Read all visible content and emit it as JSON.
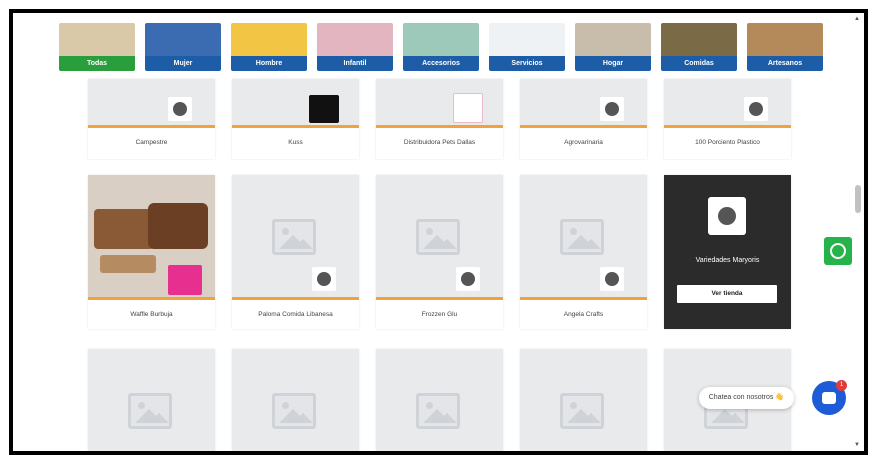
{
  "categories": [
    {
      "label": "Todas",
      "active": true,
      "color": "#d9c9a8"
    },
    {
      "label": "Mujer",
      "active": false,
      "color": "#3b6bb0"
    },
    {
      "label": "Hombre",
      "active": false,
      "color": "#f3c545"
    },
    {
      "label": "Infantil",
      "active": false,
      "color": "#e3b5c0"
    },
    {
      "label": "Accesorios",
      "active": false,
      "color": "#9cc9b9"
    },
    {
      "label": "Servicios",
      "active": false,
      "color": "#eef2f4"
    },
    {
      "label": "Hogar",
      "active": false,
      "color": "#c7bdaa"
    },
    {
      "label": "Comidas",
      "active": false,
      "color": "#7a6a45"
    },
    {
      "label": "Artesanos",
      "active": false,
      "color": "#b48a5a"
    }
  ],
  "row1": [
    {
      "name": "Campestre"
    },
    {
      "name": "Kuss"
    },
    {
      "name": "Distribuidora Pets Dallas"
    },
    {
      "name": "Agrovarinaria"
    },
    {
      "name": "100 Porciento Plastico"
    }
  ],
  "row2": [
    {
      "name": "Waffle Burbuja"
    },
    {
      "name": "Paloma Comida Libanesa"
    },
    {
      "name": "Frozzen Glu"
    },
    {
      "name": "Angela Crafts"
    }
  ],
  "featured": {
    "title": "Variedades Maryoris",
    "button": "Ver tienda"
  },
  "chat": {
    "pill_text": "Chatea con nosotros 👋",
    "badge": "1"
  },
  "colors": {
    "active_tab": "#2a9d3c",
    "tab": "#1d5da8",
    "accent_bar": "#f2a23a",
    "whatsapp": "#25b34a",
    "chat": "#1e5bd6"
  }
}
